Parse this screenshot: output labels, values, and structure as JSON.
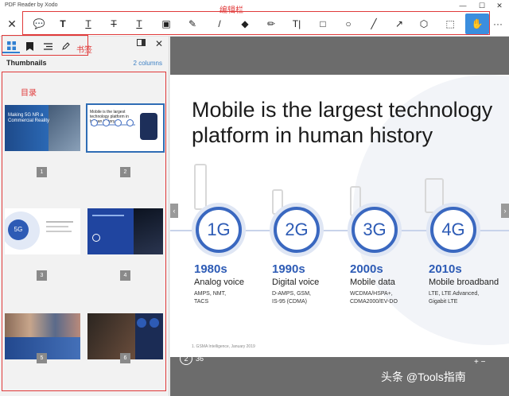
{
  "window": {
    "title": "PDF Reader by Xodo",
    "min": "—",
    "max": "☐",
    "close": "✕"
  },
  "toolbar": {
    "close": "✕",
    "tools": [
      {
        "name": "comment-icon",
        "glyph": "💬"
      },
      {
        "name": "text-box-icon",
        "glyph": "T"
      },
      {
        "name": "underline-icon",
        "glyph": "T"
      },
      {
        "name": "strikethrough-icon",
        "glyph": "T"
      },
      {
        "name": "squiggly-icon",
        "glyph": "T"
      },
      {
        "name": "image-icon",
        "glyph": "▣"
      },
      {
        "name": "edit-icon",
        "glyph": "✎"
      },
      {
        "name": "pen-icon",
        "glyph": "/"
      },
      {
        "name": "eraser-icon",
        "glyph": "◆"
      },
      {
        "name": "highlighter-icon",
        "glyph": "✏"
      },
      {
        "name": "free-text-icon",
        "glyph": "T|"
      },
      {
        "name": "rectangle-icon",
        "glyph": "□"
      },
      {
        "name": "ellipse-icon",
        "glyph": "○"
      },
      {
        "name": "line-icon",
        "glyph": "╱"
      },
      {
        "name": "arrow-icon",
        "glyph": "↗"
      },
      {
        "name": "polygon-icon",
        "glyph": "⬡"
      },
      {
        "name": "selection-icon",
        "glyph": "⬚"
      },
      {
        "name": "pan-hand-icon",
        "glyph": "✋"
      }
    ],
    "more": "···",
    "annotation_label": "编辑栏"
  },
  "sidebar": {
    "heading": "Thumbnails",
    "columns": "2 columns",
    "bookmark_label": "书签",
    "toc_label": "目录",
    "page_numbers": [
      "1",
      "2",
      "3",
      "4",
      "5",
      "6"
    ],
    "thumb_texts": {
      "t1": "Making 5G NR a Commercial Reality",
      "t2": "Mobile is the largest technology platform in human history",
      "t3": "5G"
    }
  },
  "slide": {
    "title_line1": "Mobile is the largest technology",
    "title_line2": "platform in human history",
    "generations": [
      {
        "gen": "1G",
        "year": "1980s",
        "name": "Analog voice",
        "details": [
          "AMPS, NMT,",
          "TACS"
        ]
      },
      {
        "gen": "2G",
        "year": "1990s",
        "name": "Digital voice",
        "details": [
          "D-AMPS, GSM,",
          "IS-95 (CDMA)"
        ]
      },
      {
        "gen": "3G",
        "year": "2000s",
        "name": "Mobile data",
        "details": [
          "WCDMA/HSPA+,",
          "CDMA2000/EV-DO"
        ]
      },
      {
        "gen": "4G",
        "year": "2010s",
        "name": "Mobile broadband",
        "details": [
          "LTE, LTE Advanced,",
          "Gigabit LTE"
        ]
      }
    ],
    "footnote": "1. GSMA Intelligence, January 2019"
  },
  "footer": {
    "page_circle": "2",
    "page_count": "36",
    "plusminus": "+ −",
    "watermark": "头条 @Tools指南"
  },
  "colors": {
    "accent": "#2d5bb5",
    "toolbar_active": "#3b8ede",
    "annotation_red": "#e03a3a"
  }
}
